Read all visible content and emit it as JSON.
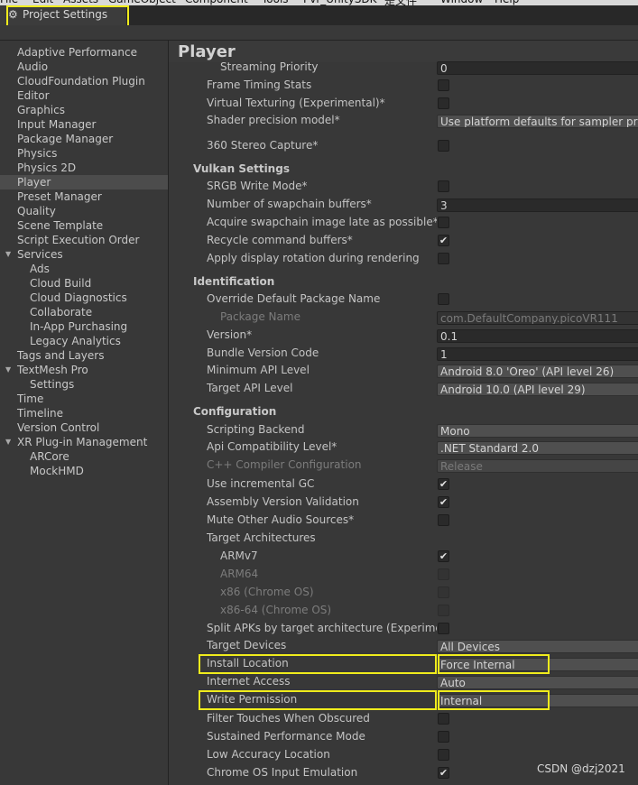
{
  "menu": [
    "File",
    "Edit",
    "Assets",
    "GameObject",
    "Component",
    "Tools",
    "Pvr_UnitySDK",
    "是文件",
    "Window",
    "Help"
  ],
  "window": {
    "tab_title": "Project Settings"
  },
  "sidebar": {
    "items": [
      {
        "label": "Adaptive Performance",
        "level": 0
      },
      {
        "label": "Audio",
        "level": 0
      },
      {
        "label": "CloudFoundation Plugin",
        "level": 0
      },
      {
        "label": "Editor",
        "level": 0
      },
      {
        "label": "Graphics",
        "level": 0
      },
      {
        "label": "Input Manager",
        "level": 0
      },
      {
        "label": "Package Manager",
        "level": 0
      },
      {
        "label": "Physics",
        "level": 0
      },
      {
        "label": "Physics 2D",
        "level": 0
      },
      {
        "label": "Player",
        "level": 0,
        "selected": true
      },
      {
        "label": "Preset Manager",
        "level": 0
      },
      {
        "label": "Quality",
        "level": 0
      },
      {
        "label": "Scene Template",
        "level": 0
      },
      {
        "label": "Script Execution Order",
        "level": 0
      },
      {
        "label": "Services",
        "level": 0,
        "expandable": true
      },
      {
        "label": "Ads",
        "level": 1
      },
      {
        "label": "Cloud Build",
        "level": 1
      },
      {
        "label": "Cloud Diagnostics",
        "level": 1
      },
      {
        "label": "Collaborate",
        "level": 1
      },
      {
        "label": "In-App Purchasing",
        "level": 1
      },
      {
        "label": "Legacy Analytics",
        "level": 1
      },
      {
        "label": "Tags and Layers",
        "level": 0
      },
      {
        "label": "TextMesh Pro",
        "level": 0,
        "expandable": true
      },
      {
        "label": "Settings",
        "level": 1
      },
      {
        "label": "Time",
        "level": 0
      },
      {
        "label": "Timeline",
        "level": 0
      },
      {
        "label": "Version Control",
        "level": 0
      },
      {
        "label": "XR Plug-in Management",
        "level": 0,
        "expandable": true
      },
      {
        "label": "ARCore",
        "level": 1
      },
      {
        "label": "MockHMD",
        "level": 1
      }
    ]
  },
  "content": {
    "title": "Player",
    "rows": [
      {
        "type": "field",
        "label": "Streaming Priority",
        "value": "0",
        "indent": 2
      },
      {
        "type": "check",
        "label": "Frame Timing Stats",
        "checked": false
      },
      {
        "type": "check",
        "label": "Virtual Texturing (Experimental)*",
        "checked": false
      },
      {
        "type": "dropdown",
        "label": "Shader precision model*",
        "value": "Use platform defaults for sampler precision"
      },
      {
        "type": "check",
        "label": "360 Stereo Capture*",
        "checked": false
      },
      {
        "type": "section",
        "label": "Vulkan Settings"
      },
      {
        "type": "check",
        "label": "SRGB Write Mode*",
        "checked": false
      },
      {
        "type": "field",
        "label": "Number of swapchain buffers*",
        "value": "3"
      },
      {
        "type": "check",
        "label": "Acquire swapchain image late as possible*",
        "checked": false
      },
      {
        "type": "check",
        "label": "Recycle command buffers*",
        "checked": true
      },
      {
        "type": "check",
        "label": "Apply display rotation during rendering",
        "checked": false
      },
      {
        "type": "section",
        "label": "Identification"
      },
      {
        "type": "check",
        "label": "Override Default Package Name",
        "checked": false
      },
      {
        "type": "field",
        "label": "Package Name",
        "value": "com.DefaultCompany.picoVR111",
        "indent": 2,
        "disabled": true
      },
      {
        "type": "field",
        "label": "Version*",
        "value": "0.1"
      },
      {
        "type": "field",
        "label": "Bundle Version Code",
        "value": "1"
      },
      {
        "type": "dropdown",
        "label": "Minimum API Level",
        "value": "Android 8.0 'Oreo' (API level 26)"
      },
      {
        "type": "dropdown",
        "label": "Target API Level",
        "value": "Android 10.0 (API level 29)"
      },
      {
        "type": "section",
        "label": "Configuration"
      },
      {
        "type": "dropdown",
        "label": "Scripting Backend",
        "value": "Mono"
      },
      {
        "type": "dropdown",
        "label": "Api Compatibility Level*",
        "value": ".NET Standard 2.0"
      },
      {
        "type": "dropdown",
        "label": "C++ Compiler Configuration",
        "value": "Release",
        "disabled": true
      },
      {
        "type": "check",
        "label": "Use incremental GC",
        "checked": true
      },
      {
        "type": "check",
        "label": "Assembly Version Validation",
        "checked": true
      },
      {
        "type": "check",
        "label": "Mute Other Audio Sources*",
        "checked": false
      },
      {
        "type": "label",
        "label": "Target Architectures"
      },
      {
        "type": "check",
        "label": "ARMv7",
        "checked": true,
        "indent": 2
      },
      {
        "type": "check",
        "label": "ARM64",
        "checked": false,
        "indent": 2,
        "disabled": true
      },
      {
        "type": "check",
        "label": "x86 (Chrome OS)",
        "checked": false,
        "indent": 2,
        "disabled": true
      },
      {
        "type": "check",
        "label": "x86-64 (Chrome OS)",
        "checked": false,
        "indent": 2,
        "disabled": true
      },
      {
        "type": "check",
        "label": "Split APKs by target architecture (Experimental)",
        "checked": false
      },
      {
        "type": "dropdown",
        "label": "Target Devices",
        "value": "All Devices"
      },
      {
        "type": "dropdown",
        "label": "Install Location",
        "value": "Force Internal",
        "highlight": true
      },
      {
        "type": "dropdown",
        "label": "Internet Access",
        "value": "Auto"
      },
      {
        "type": "dropdown",
        "label": "Write Permission",
        "value": "Internal",
        "highlight": true
      },
      {
        "type": "check",
        "label": "Filter Touches When Obscured",
        "checked": false
      },
      {
        "type": "check",
        "label": "Sustained Performance Mode",
        "checked": false
      },
      {
        "type": "check",
        "label": "Low Accuracy Location",
        "checked": false
      },
      {
        "type": "check",
        "label": "Chrome OS Input Emulation",
        "checked": true
      }
    ]
  },
  "watermark": "CSDN @dzj2021",
  "colors": {
    "highlight": "#f0ec1c",
    "background": "#383838",
    "selected": "#4c4c4c"
  }
}
